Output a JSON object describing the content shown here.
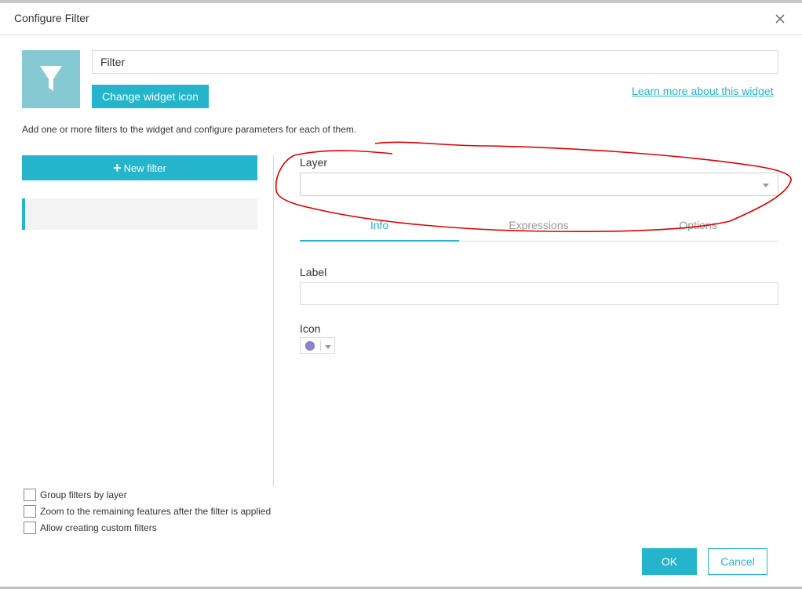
{
  "window": {
    "title": "Configure Filter"
  },
  "widget": {
    "name_value": "Filter",
    "change_icon_label": "Change widget icon",
    "learn_more_label": "Learn more about this widget",
    "description": "Add one or more filters to the widget and configure parameters for each of them."
  },
  "filters": {
    "new_filter_label": "New filter"
  },
  "layer": {
    "label": "Layer",
    "selected_value": ""
  },
  "tabs": [
    {
      "label": "Info",
      "active": true
    },
    {
      "label": "Expressions",
      "active": false
    },
    {
      "label": "Options",
      "active": false
    }
  ],
  "info": {
    "label_title": "Label",
    "label_value": "",
    "icon_title": "Icon",
    "icon_color": "#8c83d1"
  },
  "options": [
    {
      "label": "Group filters by layer",
      "checked": false
    },
    {
      "label": "Zoom to the remaining features after the filter is applied",
      "checked": false
    },
    {
      "label": "Allow creating custom filters",
      "checked": false
    }
  ],
  "footer": {
    "ok_label": "OK",
    "cancel_label": "Cancel"
  },
  "colors": {
    "accent": "#24b5cc",
    "icon_box": "#86c9d3",
    "annotation": "#e00000"
  }
}
